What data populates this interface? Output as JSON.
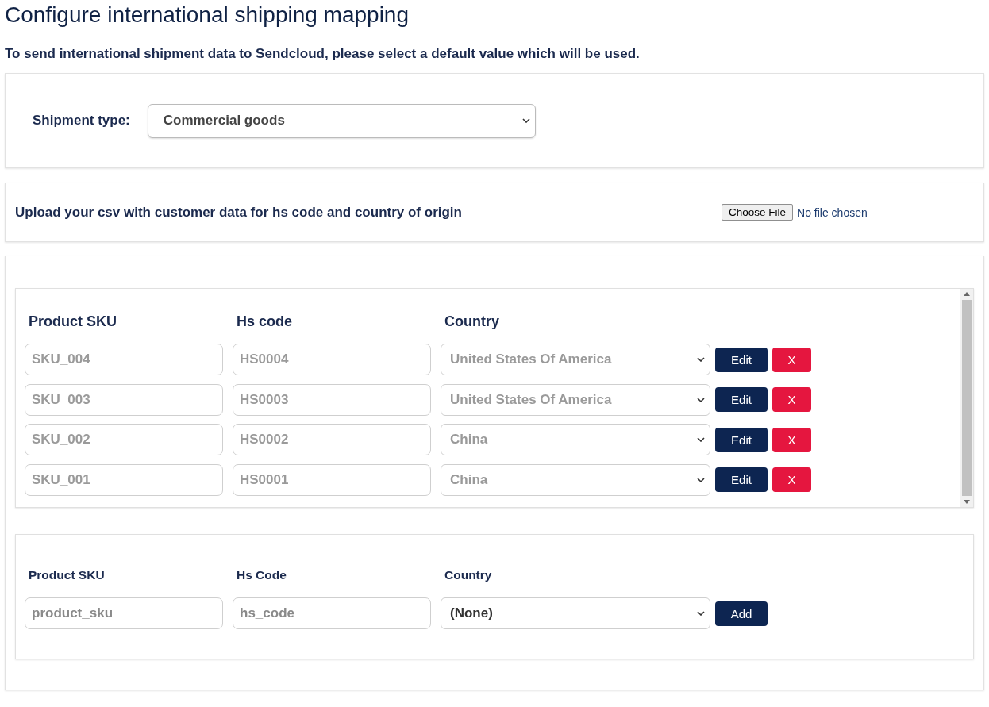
{
  "title": "Configure international shipping mapping",
  "intro": "To send international shipment data to Sendcloud, please select a default value which will be used.",
  "shipment_type": {
    "label": "Shipment type:",
    "value": "Commercial goods"
  },
  "upload": {
    "label": "Upload your csv with customer data for hs code and country of origin",
    "button": "Choose File",
    "status": "No file chosen"
  },
  "mappings": {
    "columns": [
      "Product SKU",
      "Hs code",
      "Country"
    ],
    "rows": [
      {
        "sku": "SKU_004",
        "hs_code": "HS0004",
        "country": "United States Of America",
        "disabled": true,
        "edit": "Edit",
        "remove": "X"
      },
      {
        "sku": "SKU_003",
        "hs_code": "HS0003",
        "country": "United States Of America",
        "disabled": true,
        "edit": "Edit",
        "remove": "X"
      },
      {
        "sku": "SKU_002",
        "hs_code": "HS0002",
        "country": "China",
        "disabled": true,
        "edit": "Edit",
        "remove": "X"
      },
      {
        "sku": "SKU_001",
        "hs_code": "HS0001",
        "country": "China",
        "disabled": true,
        "edit": "Edit",
        "remove": "X"
      }
    ]
  },
  "new_mapping": {
    "columns": [
      "Product SKU",
      "Hs Code",
      "Country"
    ],
    "sku_placeholder": "product_sku",
    "hs_placeholder": "hs_code",
    "country": "(None)",
    "button": "Add"
  }
}
